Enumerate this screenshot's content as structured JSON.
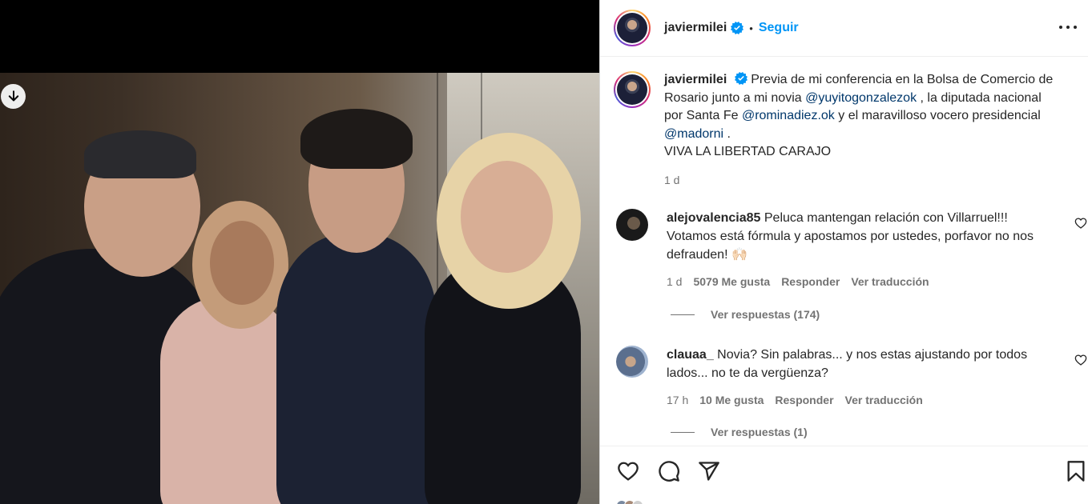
{
  "post": {
    "username": "javiermilei",
    "follow_label": "Seguir",
    "separator": "•"
  },
  "caption": {
    "username": "javiermilei",
    "text_1": "Previa de mi conferencia en la Bolsa de Comercio de Rosario junto a mi novia ",
    "mention_1": "@yuyitogonzalezok",
    "text_2": " , la diputada nacional por Santa Fe ",
    "mention_2": "@rominadiez.ok",
    "text_3": " y el maravilloso vocero presidencial ",
    "mention_3": "@madorni",
    "text_4": " .",
    "line_2": "VIVA LA LIBERTAD CARAJO",
    "time": "1 d"
  },
  "comments": [
    {
      "username": "alejovalencia85",
      "text": "Peluca mantengan relación con Villarruel!!! Votamos está fórmula y apostamos por ustedes, porfavor no nos defrauden! 🙌🏻",
      "time": "1 d",
      "likes": "5079 Me gusta",
      "reply_label": "Responder",
      "translate_label": "Ver traducción",
      "replies_label": "Ver respuestas (174)"
    },
    {
      "username": "clauaa_",
      "text": "Novia? Sin palabras... y nos estas ajustando por todos lados... no te da vergüenza?",
      "time": "17 h",
      "likes": "10 Me gusta",
      "reply_label": "Responder",
      "translate_label": "Ver traducción",
      "replies_label": "Ver respuestas (1)"
    }
  ],
  "icons": {
    "download": "arrow-down-circle-icon",
    "more": "more-horizontal-icon",
    "verified": "verified-badge-icon",
    "like": "heart-icon",
    "comment": "comment-bubble-icon",
    "share": "paper-plane-icon",
    "save": "bookmark-icon"
  },
  "colors": {
    "accent": "#0095f6",
    "mention": "#00376b",
    "secondary_text": "#737373",
    "verified": "#0095f6"
  }
}
